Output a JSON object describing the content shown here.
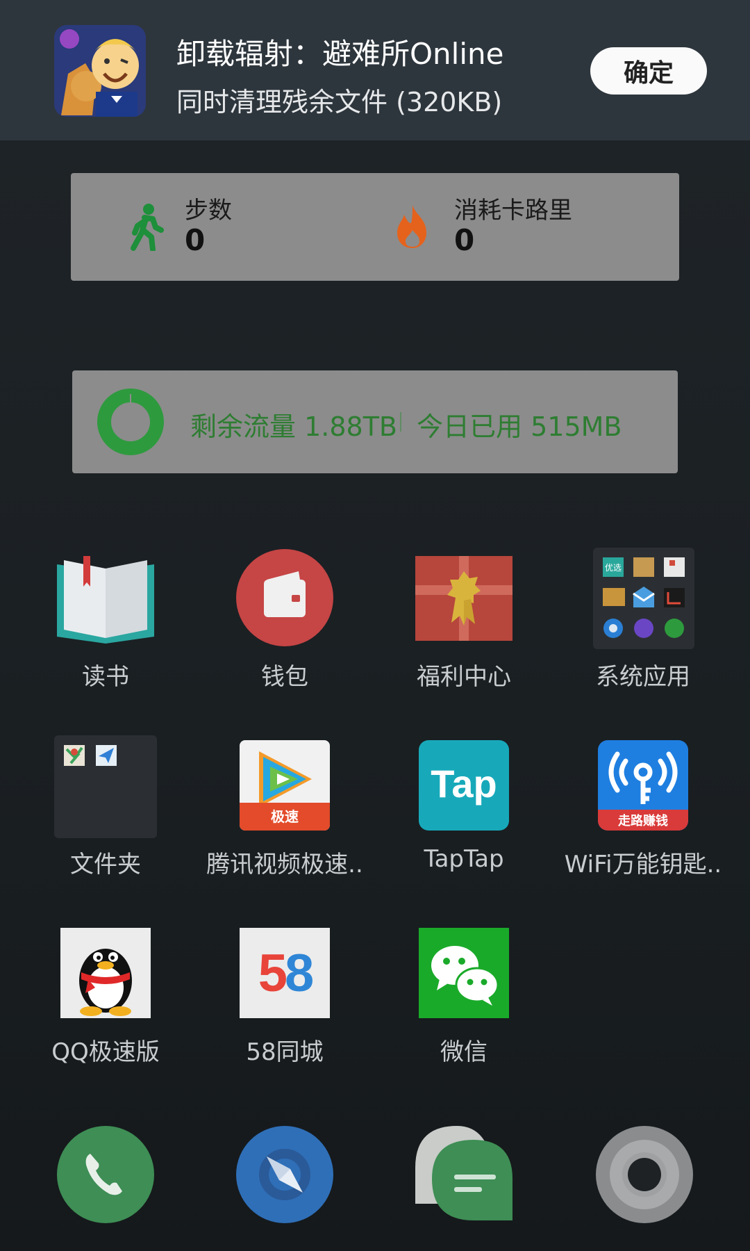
{
  "notification": {
    "title": "卸载辐射：避难所Online",
    "subtitle": "同时清理残余文件 (320KB)",
    "confirm_label": "确定",
    "app_icon": "fallout-shelter-app-icon"
  },
  "health_widget": {
    "steps_label": "步数",
    "steps_value": "0",
    "calories_label": "消耗卡路里",
    "calories_value": "0"
  },
  "data_widget": {
    "remaining_label": "剩余流量",
    "remaining_value": "1.88TB",
    "used_label": "今日已用",
    "used_value": "515MB",
    "accent_color": "#2e9a3e"
  },
  "apps": [
    {
      "label": "读书",
      "icon": "book-icon"
    },
    {
      "label": "钱包",
      "icon": "wallet-icon"
    },
    {
      "label": "福利中心",
      "icon": "gift-icon"
    },
    {
      "label": "系统应用",
      "icon": "folder-system-apps-icon"
    },
    {
      "label": "文件夹",
      "icon": "folder-icon"
    },
    {
      "label": "腾讯视频极速..",
      "icon": "tencent-video-icon",
      "badge": "极速"
    },
    {
      "label": "TapTap",
      "icon": "taptap-icon",
      "icon_text": "Tap"
    },
    {
      "label": "WiFi万能钥匙..",
      "icon": "wifi-key-icon",
      "badge": "走路赚钱"
    },
    {
      "label": "QQ极速版",
      "icon": "qq-icon"
    },
    {
      "label": "58同城",
      "icon": "58-icon",
      "icon_text": "58"
    },
    {
      "label": "微信",
      "icon": "wechat-icon"
    }
  ],
  "folder_mini": {
    "label": "优选"
  },
  "dock": [
    "phone-icon",
    "browser-icon",
    "messages-icon",
    "camera-icon"
  ]
}
